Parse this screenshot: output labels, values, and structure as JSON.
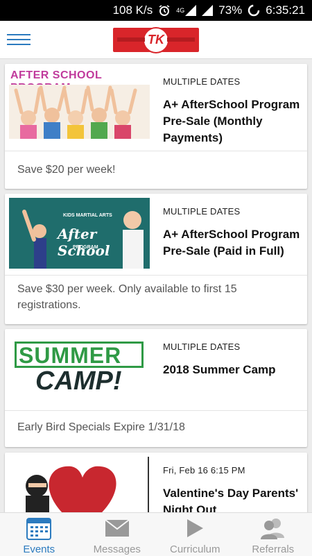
{
  "status": {
    "speed": "108 K/s",
    "network": "4G",
    "battery": "73%",
    "time": "6:35:21"
  },
  "header": {
    "logo_text": "TK"
  },
  "events": [
    {
      "image_text": "AFTER SCHOOL PROGRAM",
      "dates": "MULTIPLE DATES",
      "title": "A+ AfterSchool Program Pre-Sale (Monthly Payments)",
      "desc": "Save $20 per week!"
    },
    {
      "image_text": "After School",
      "image_subtext": "PROGRAM",
      "image_badge": "KIDS MARTIAL ARTS",
      "dates": "MULTIPLE DATES",
      "title": "A+ AfterSchool Program Pre-Sale (Paid in Full)",
      "desc": "Save $30 per week. Only available to first 15 registrations."
    },
    {
      "image_text": "SUMMER",
      "image_subtext": "CAMP!",
      "dates": "MULTIPLE DATES",
      "title": "2018 Summer Camp",
      "desc": "Early Bird Specials Expire 1/31/18"
    },
    {
      "dates": "Fri, Feb 16 6:15 PM",
      "title": "Valentine's Day Parents' Night Out"
    }
  ],
  "tabs": [
    {
      "label": "Events",
      "icon": "calendar-icon",
      "active": true
    },
    {
      "label": "Messages",
      "icon": "envelope-icon",
      "active": false
    },
    {
      "label": "Curriculum",
      "icon": "play-icon",
      "active": false
    },
    {
      "label": "Referrals",
      "icon": "people-icon",
      "active": false
    }
  ],
  "colors": {
    "accent": "#2c7bbf",
    "brand_red": "#d9252a"
  }
}
